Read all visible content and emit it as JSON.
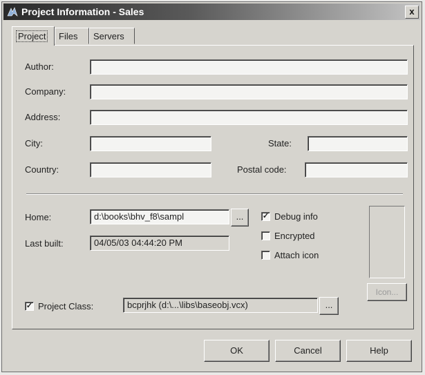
{
  "window": {
    "title": "Project Information - Sales",
    "close_label": "x"
  },
  "tabs": [
    {
      "label": "Project"
    },
    {
      "label": "Files"
    },
    {
      "label": "Servers"
    }
  ],
  "form": {
    "author": {
      "label": "Author:",
      "value": ""
    },
    "company": {
      "label": "Company:",
      "value": ""
    },
    "address": {
      "label": "Address:",
      "value": ""
    },
    "city": {
      "label": "City:",
      "value": ""
    },
    "state": {
      "label": "State:",
      "value": ""
    },
    "country": {
      "label": "Country:",
      "value": ""
    },
    "postal_code": {
      "label": "Postal code:",
      "value": ""
    },
    "home": {
      "label": "Home:",
      "value": "d:\\books\\bhv_f8\\sampl",
      "browse_label": "..."
    },
    "last_built": {
      "label": "Last built:",
      "value": "04/05/03 04:44:20 PM"
    },
    "debug_info": {
      "label": "Debug info",
      "checked": true
    },
    "encrypted": {
      "label": "Encrypted",
      "checked": false
    },
    "attach_icon": {
      "label": "Attach icon",
      "checked": false
    },
    "icon_button": "Icon...",
    "project_class": {
      "label": "Project Class:",
      "checked": true,
      "value": "bcprjhk (d:\\...\\libs\\baseobj.vcx)",
      "browse_label": "..."
    }
  },
  "buttons": {
    "ok": "OK",
    "cancel": "Cancel",
    "help": "Help"
  },
  "checkmark": "✓"
}
